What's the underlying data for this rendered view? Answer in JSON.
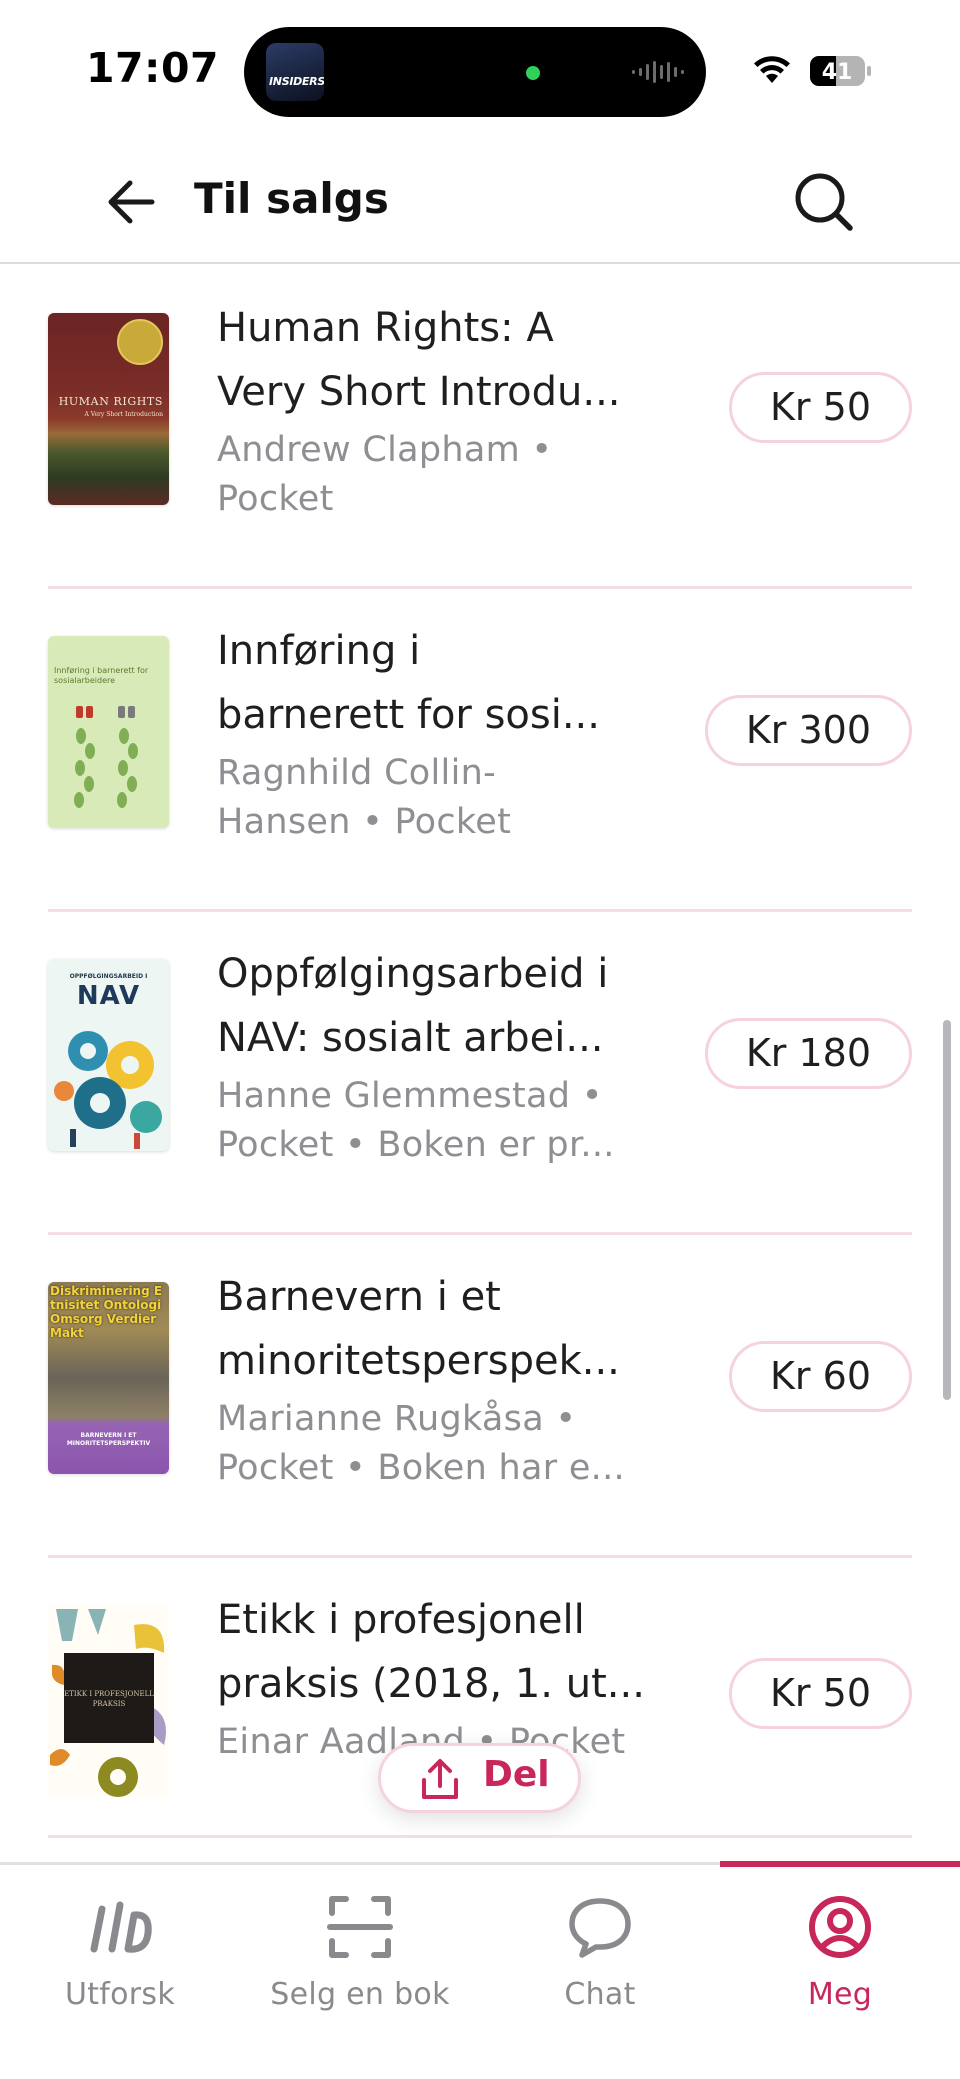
{
  "status_bar": {
    "time": "17:07",
    "live_activity_label": "INSIDERS",
    "battery": "41"
  },
  "header": {
    "title": "Til salgs"
  },
  "books": [
    {
      "title_lines": [
        "Human Rights: A",
        "Very Short Introdu..."
      ],
      "meta_lines": [
        "Andrew Clapham •",
        "Pocket"
      ],
      "price": "Kr 50",
      "cover_text": "HUMAN RIGHTS",
      "cover_subtitle": "A Very Short Introduction"
    },
    {
      "title_lines": [
        "Innføring i",
        "barnerett for sosi..."
      ],
      "meta_lines": [
        "Ragnhild Collin-",
        "Hansen • Pocket"
      ],
      "price": "Kr 300",
      "cover_text": "Innføring i barnerett for sosialarbeidere"
    },
    {
      "title_lines": [
        "Oppfølgingsarbeid i",
        "NAV: sosialt arbei..."
      ],
      "meta_lines": [
        "Hanne Glemmestad •",
        "Pocket • Boken er pr..."
      ],
      "price": "Kr 180",
      "cover_text": "NAV",
      "cover_subtitle": "OPPFØLGINGSARBEID I"
    },
    {
      "title_lines": [
        "Barnevern i et",
        "minoritetsperspek..."
      ],
      "meta_lines": [
        "Marianne Rugkåsa •",
        "Pocket • Boken har e..."
      ],
      "price": "Kr 60",
      "cover_text": "Diskriminering Etnisitet Ontologi Omsorg Verdier Makt",
      "cover_subtitle": "BARNEVERN I ET MINORITETSPERSPEKTIV"
    },
    {
      "title_lines": [
        "Etikk i profesjonell",
        "praksis (2018, 1. ut..."
      ],
      "meta_lines": [
        "Einar Aadland • Pocket"
      ],
      "price": "Kr 50",
      "cover_text": "ETIKK I PROFESJONELL PRAKSIS"
    }
  ],
  "share_button": {
    "label": "Del"
  },
  "tab_bar": {
    "tabs": [
      {
        "label": "Utforsk",
        "icon": "logo-icon"
      },
      {
        "label": "Selg en bok",
        "icon": "scan-icon"
      },
      {
        "label": "Chat",
        "icon": "chat-bubble-icon"
      },
      {
        "label": "Meg",
        "icon": "profile-icon",
        "active": true
      }
    ]
  },
  "colors": {
    "accent": "#c8275a",
    "pill_border": "#f6d3dc",
    "divider": "#f6dde3",
    "muted_text": "#8e8e93"
  }
}
